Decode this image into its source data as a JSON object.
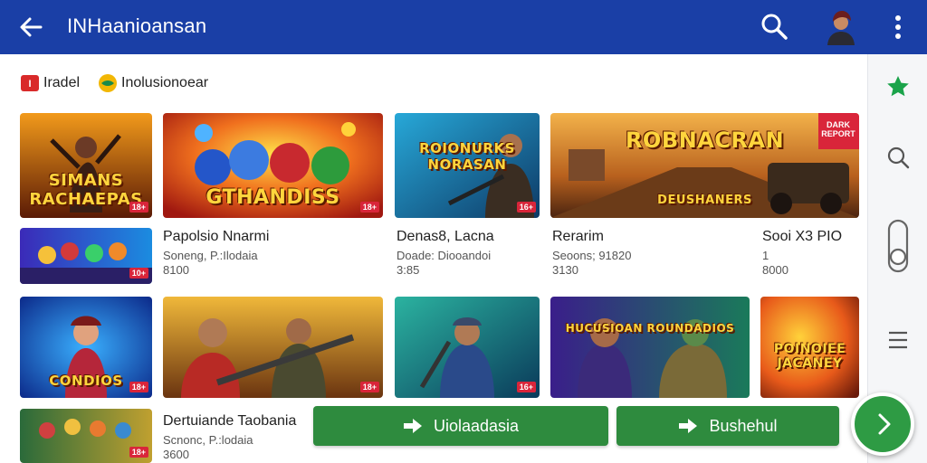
{
  "appbar": {
    "title": "INHaanioansan"
  },
  "filters": [
    {
      "label": "Iradel",
      "icon": "store-icon"
    },
    {
      "label": "Inolusionoear",
      "icon": "globe-icon"
    }
  ],
  "row1": [
    {
      "caption": "SIMANS RACHAEPAS",
      "badge": "18+"
    },
    {
      "caption": "GTHANDISS",
      "badge": "18+"
    },
    {
      "caption": "ROIONURKS NORASAN",
      "badge": "16+"
    },
    {
      "caption": "ROBNACRAN",
      "sub_caption": "DEUSHANERS",
      "corner": "DARK REPORT"
    }
  ],
  "row2_thumb_badge": "10+",
  "row2_info": [
    {
      "name": "Papolsio Nnarmi",
      "line1": "Soneng, P.:Ilodaia",
      "line2": "8100"
    },
    {
      "name": "Denas8, Lacna",
      "line1": "Doade: Diooandoi",
      "line2": "3:85"
    },
    {
      "name": "Rerarim",
      "line1": "Seoons; 91820",
      "line2": "3130"
    },
    {
      "name": "Sooi X3 PIO",
      "line1": "1",
      "line2": "8000"
    }
  ],
  "row3": [
    {
      "caption": "CONDIOS",
      "badge": "18+"
    },
    {
      "caption": "",
      "badge": "18+"
    },
    {
      "caption": "",
      "badge": "16+"
    },
    {
      "caption": "HUCUSIOAN ROUNDADIOS",
      "badge": ""
    },
    {
      "caption": "POINOIEE JACANEY",
      "badge": ""
    }
  ],
  "row4_thumb_badge": "18+",
  "row4_info": {
    "name": "Dertuiande Taobania",
    "line1": "Scnonc, P.:lodaia",
    "line2": "3600"
  },
  "buttons": {
    "primary": "Uiolaadasia",
    "secondary": "Bushehul"
  },
  "colors": {
    "appbar": "#1a3fa6",
    "button": "#2e8b3e",
    "fab": "#2e9b44",
    "star": "#1aa34a"
  }
}
